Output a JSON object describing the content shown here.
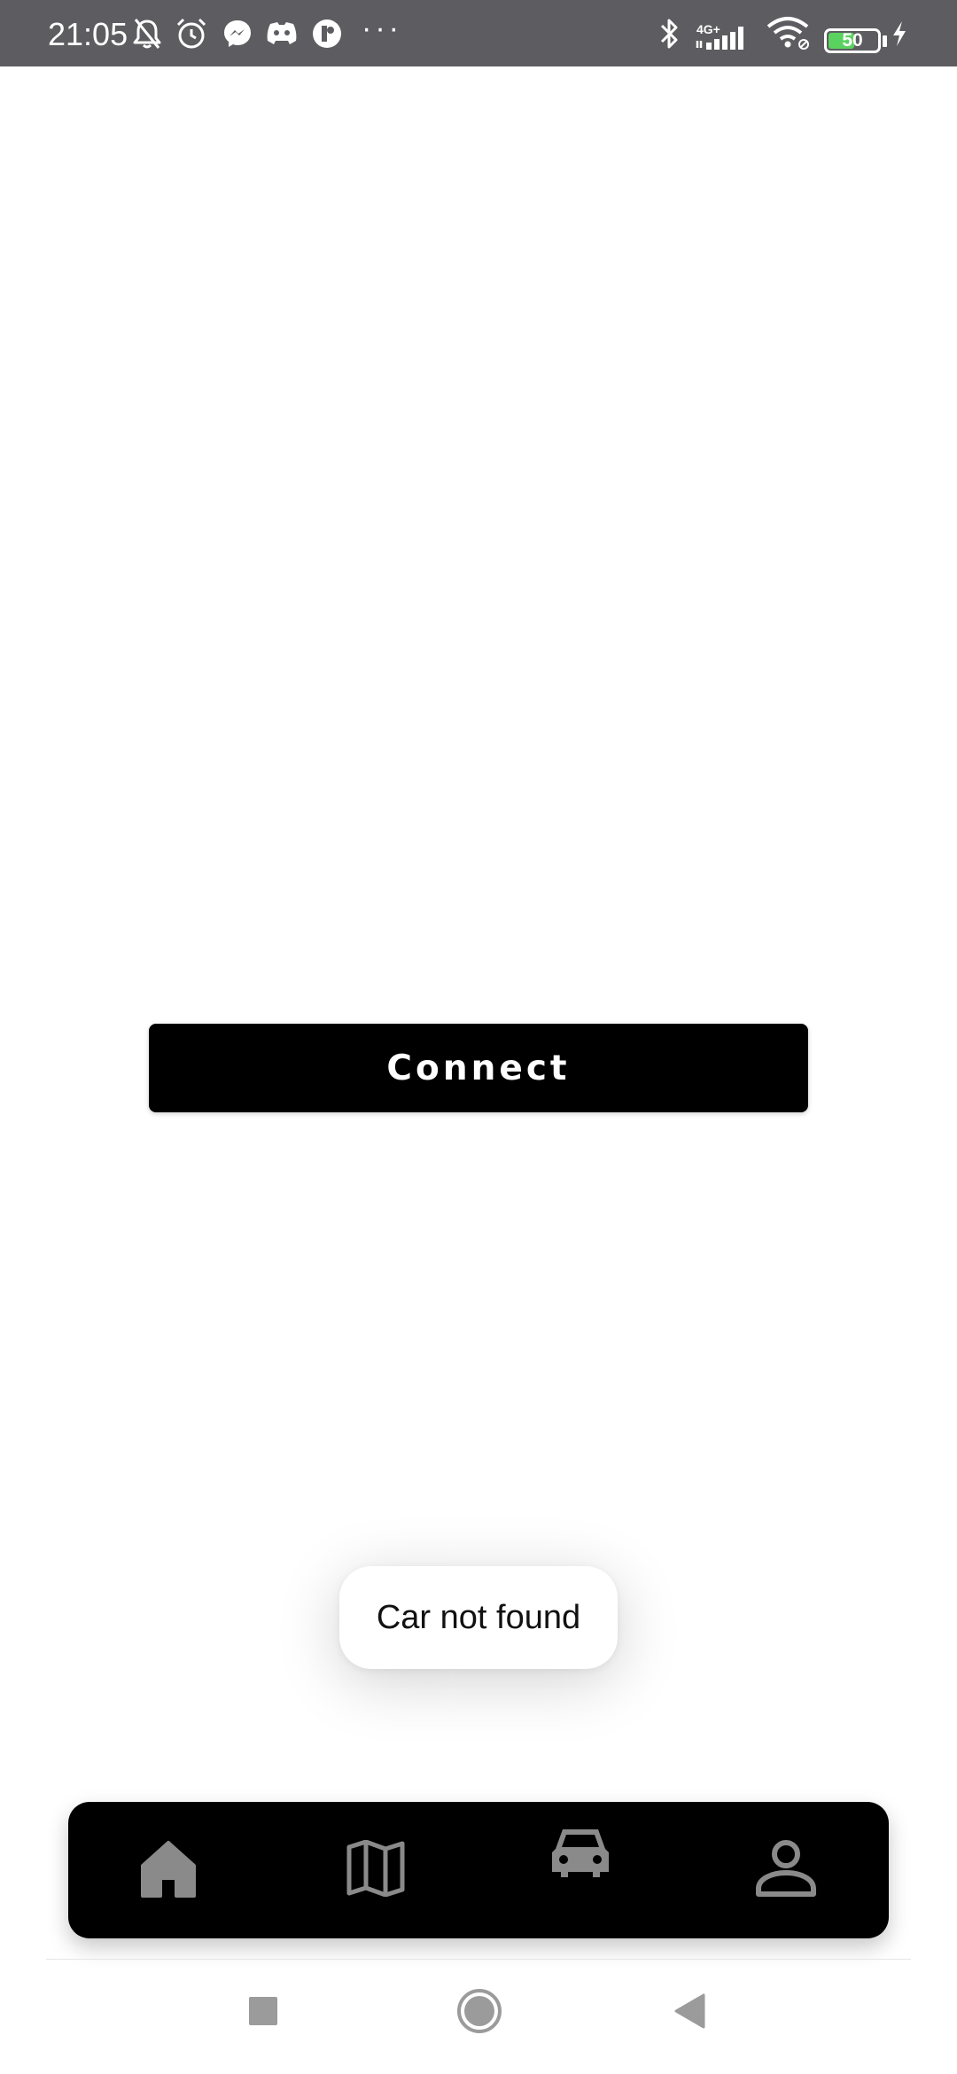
{
  "status_bar": {
    "time": "21:05",
    "network_label": "4G+",
    "battery_level": "50",
    "battery_fraction": 0.5,
    "overflow": "···"
  },
  "main": {
    "connect_label": "Connect"
  },
  "toast": {
    "message": "Car not found"
  },
  "bottom_nav": {
    "items": [
      {
        "icon": "home-icon"
      },
      {
        "icon": "map-icon"
      },
      {
        "icon": "car-icon"
      },
      {
        "icon": "person-icon"
      }
    ]
  },
  "system_nav": {
    "buttons": [
      "recents",
      "home",
      "back"
    ]
  },
  "colors": {
    "status_bar": "#5d5d61",
    "accent_button": "#000000",
    "nav_icon": "#8a8a8a",
    "battery": "#5ad25f"
  }
}
